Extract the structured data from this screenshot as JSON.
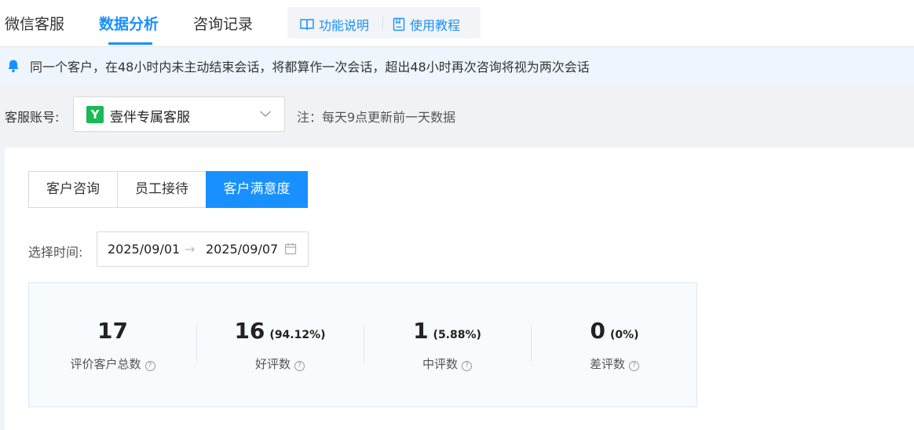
{
  "header": {
    "tabs": [
      "微信客服",
      "数据分析",
      "咨询记录"
    ],
    "active_tab": "数据分析",
    "help_links": [
      "功能说明",
      "使用教程"
    ]
  },
  "notice": {
    "icon": "bell-icon",
    "text": "同一个客户，在48小时内未主动结束会话，将都算作一次会话，超出48小时再次咨询将视为两次会话"
  },
  "account": {
    "label": "客服账号:",
    "selected": "壹伴专属客服",
    "logo_letter": "Y",
    "note": "注：每天9点更新前一天数据"
  },
  "segments": {
    "items": [
      "客户咨询",
      "员工接待",
      "客户满意度"
    ],
    "active": "客户满意度"
  },
  "time_filter": {
    "label": "选择时间:",
    "start": "2025/09/01",
    "arrow": "→",
    "end": "2025/09/07"
  },
  "stats": [
    {
      "value": "17",
      "percent": "",
      "label": "评价客户总数"
    },
    {
      "value": "16",
      "percent": "(94.12%)",
      "label": "好评数"
    },
    {
      "value": "1",
      "percent": "(5.88%)",
      "label": "中评数"
    },
    {
      "value": "0",
      "percent": "(0%)",
      "label": "差评数"
    }
  ],
  "colors": {
    "accent": "#1890ff",
    "notice_bg": "#eef5fd",
    "stats_bg": "#f7fbfe",
    "brand_green": "#19b955"
  }
}
